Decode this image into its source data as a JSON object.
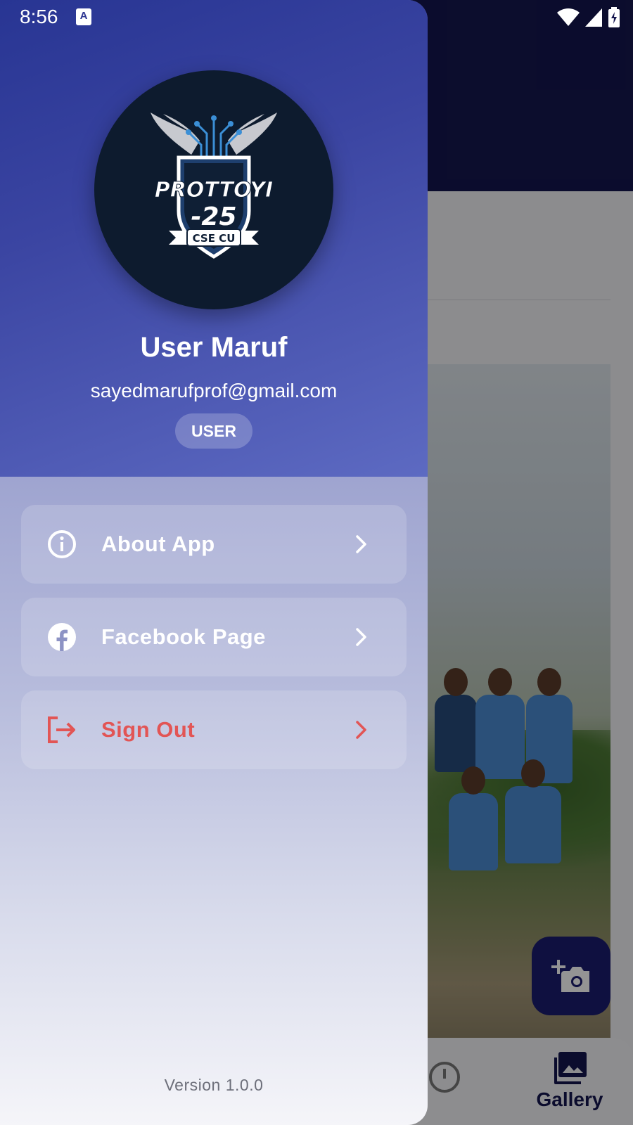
{
  "status_bar": {
    "time": "8:56",
    "notification_icon": "A"
  },
  "profile": {
    "logo_text": "PROTTOYI",
    "logo_number": "-25",
    "logo_banner": "CSE CU",
    "name": "User Maruf",
    "email": "sayedmarufprof@gmail.com",
    "role": "USER"
  },
  "menu": {
    "items": [
      {
        "label": "About App",
        "icon": "info-icon"
      },
      {
        "label": "Facebook Page",
        "icon": "facebook-icon"
      },
      {
        "label": "Sign Out",
        "icon": "logout-icon",
        "color": "#e25555"
      }
    ]
  },
  "footer": {
    "version": "Version 1.0.0"
  },
  "background_app": {
    "active_tab": "Gallery",
    "fab_icon": "add-photo-icon"
  },
  "colors": {
    "header_start": "#283593",
    "header_end": "#5d6ac2",
    "signout": "#e25555",
    "topbar": "#14164e"
  }
}
